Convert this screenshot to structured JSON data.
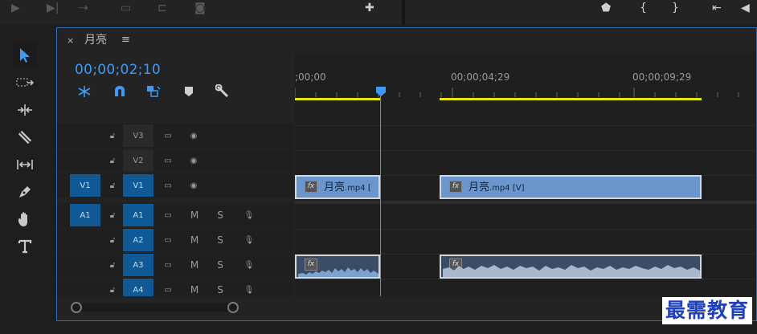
{
  "sequence": {
    "tab_title": "月亮",
    "timecode": "00;00;02;10",
    "ruler_labels": [
      ";00;00",
      "00;00;04;29",
      "00;00;09;29"
    ]
  },
  "tracks": {
    "video": [
      {
        "name": "V3",
        "source": "",
        "locked_icon": "lock-open-icon"
      },
      {
        "name": "V2",
        "source": "",
        "locked_icon": "lock-open-icon"
      },
      {
        "name": "V1",
        "source": "V1",
        "locked_icon": "lock-open-icon"
      }
    ],
    "audio": [
      {
        "name": "A1",
        "source": "A1",
        "m": "M",
        "s": "S"
      },
      {
        "name": "A2",
        "source": "",
        "m": "M",
        "s": "S"
      },
      {
        "name": "A3",
        "source": "",
        "m": "M",
        "s": "S"
      },
      {
        "name": "A4",
        "source": "",
        "m": "M",
        "s": "S"
      }
    ]
  },
  "clips": {
    "video_clip_1": {
      "name": "月亮",
      "ext": ".mp4 ["
    },
    "video_clip_2": {
      "name": "月亮",
      "ext": ".mp4 [V]"
    },
    "fx": "fx"
  },
  "watermark": "最需教育",
  "colors": {
    "accent": "#3d9bf5",
    "track_target": "#0f5a96",
    "video_clip": "#6b96cb",
    "audio_clip": "#3a4c66",
    "work_area": "#e8e800"
  },
  "icons": [
    "play-icon",
    "step-icon",
    "insert-icon",
    "export-icon",
    "camera-icon",
    "add-icon",
    "marker-icon",
    "selection-tool-icon",
    "track-select-icon",
    "ripple-edit-icon",
    "razor-icon",
    "slip-icon",
    "pen-icon",
    "hand-icon",
    "type-icon",
    "snap-icon",
    "linked-selection-icon",
    "add-marker-icon",
    "wrench-icon",
    "eye-icon",
    "film-icon",
    "mic-icon"
  ]
}
